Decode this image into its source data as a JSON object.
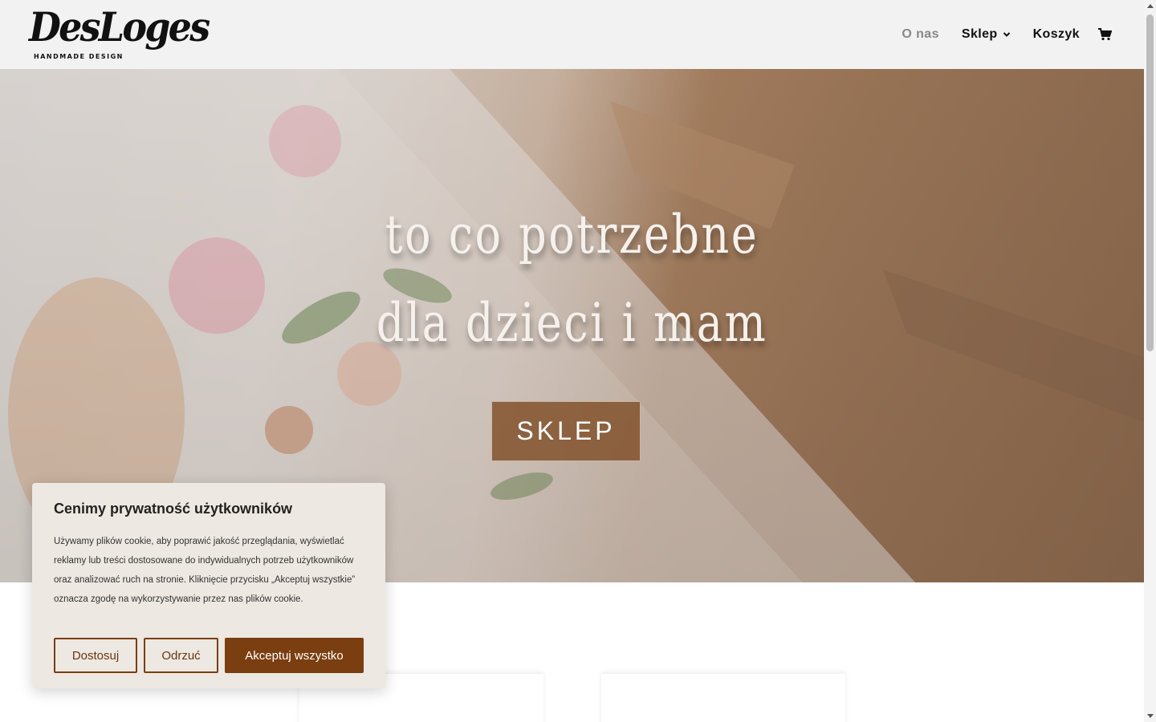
{
  "brand": {
    "logo_text": "DesLoges",
    "logo_subtitle": "HANDMADE DESIGN"
  },
  "nav": {
    "items": [
      {
        "label": "O nas",
        "active": true
      },
      {
        "label": "Sklep",
        "has_dropdown": true
      },
      {
        "label": "Koszyk"
      }
    ],
    "cart_icon": "cart-icon"
  },
  "hero": {
    "line1": "to co potrzebne",
    "line2": "dla dzieci i mam",
    "button_label": "SKLEP"
  },
  "cookie": {
    "title": "Cenimy prywatność użytkowników",
    "text": "Używamy plików cookie, aby poprawić jakość przeglądania, wyświetlać reklamy lub treści dostosowane do indywidualnych potrzeb użytkowników oraz analizować ruch na stronie. Kliknięcie przycisku „Akceptuj wszystkie” oznacza zgodę na wykorzystywanie przez nas plików cookie.",
    "customize_label": "Dostosuj",
    "reject_label": "Odrzuć",
    "accept_label": "Akceptuj wszystko"
  },
  "colors": {
    "accent": "#7a3e10",
    "header_bg": "#f2f2f2",
    "cookie_bg": "#ede8e1"
  }
}
